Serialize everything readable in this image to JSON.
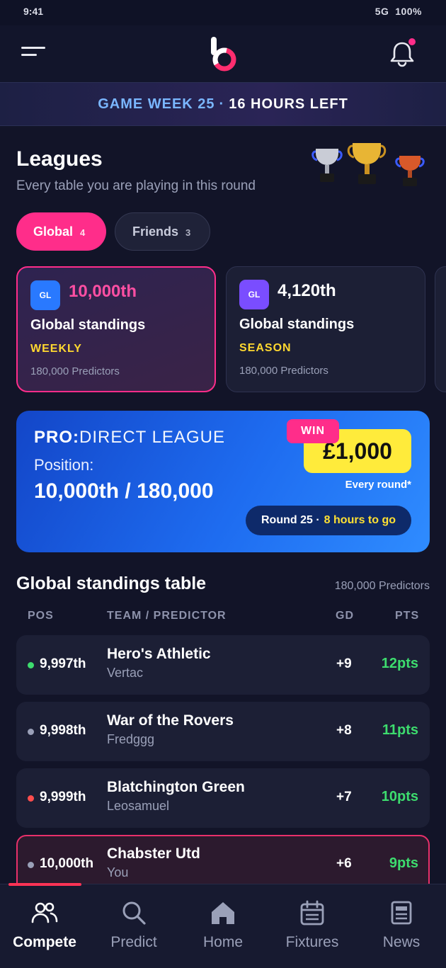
{
  "status_bar": {
    "time": "9:41",
    "network": "5G",
    "battery": "100%"
  },
  "header": {
    "menu_icon": "menu-icon",
    "logo": "b",
    "bell_icon": "bell-icon",
    "has_notification": true
  },
  "game_week": {
    "label": "GAME WEEK 25",
    "separator": "·",
    "time_left": "16 HOURS LEFT"
  },
  "leagues": {
    "title": "Leagues",
    "subtitle": "Every table you are playing in this round",
    "tabs": [
      {
        "label": "Global",
        "count": "4",
        "selected": true
      },
      {
        "label": "Friends",
        "count": "3",
        "selected": false
      }
    ],
    "cards": [
      {
        "badge": "GL",
        "rank": "10,000th",
        "name": "Global standings",
        "period": "WEEKLY",
        "predictors": "180,000 Predictors",
        "badge_color": "#2979ff",
        "rank_color": "#ff4fa3",
        "active": true
      },
      {
        "badge": "GL",
        "rank": "4,120th",
        "name": "Global standings",
        "period": "SEASON",
        "predictors": "180,000 Predictors",
        "badge_color": "#7a4dff",
        "rank_color": "#ffffff",
        "active": false
      }
    ]
  },
  "promo": {
    "brand_bold": "PRO:",
    "brand_thin": "DIRECT",
    "brand_suffix": "LEAGUE",
    "position_label": "Position:",
    "position_value": "10,000th / 180,000",
    "win_tag": "WIN",
    "prize": "£1,000",
    "prize_note": "Every round*",
    "round": "Round 25 ·",
    "round_time": "8 hours to go"
  },
  "standings": {
    "title": "Global standings table",
    "count": "180,000 Predictors",
    "columns": {
      "pos": "POS",
      "team": "TEAM / PREDICTOR",
      "gd": "GD",
      "pts": "PTS"
    },
    "rows": [
      {
        "pos": "9,997th",
        "team": "Hero's Athletic",
        "user": "Vertac",
        "gd": "+9",
        "pts": "12pts",
        "trend_color": "#3ddc6e",
        "you": false
      },
      {
        "pos": "9,998th",
        "team": "War of the Rovers",
        "user": "Fredggg",
        "gd": "+8",
        "pts": "11pts",
        "trend_color": "#9aa0b8",
        "you": false
      },
      {
        "pos": "9,999th",
        "team": "Blatchington Green",
        "user": "Leosamuel",
        "gd": "+7",
        "pts": "10pts",
        "trend_color": "#ff4d4d",
        "you": false
      },
      {
        "pos": "10,000th",
        "team": "Chabster Utd",
        "user": "You",
        "gd": "+6",
        "pts": "9pts",
        "trend_color": "#9aa0b8",
        "you": true
      }
    ]
  },
  "tabbar": {
    "items": [
      {
        "label": "Compete",
        "icon": "users-icon",
        "active": true
      },
      {
        "label": "Predict",
        "icon": "search-icon",
        "active": false
      },
      {
        "label": "Home",
        "icon": "home-icon",
        "active": false
      },
      {
        "label": "Fixtures",
        "icon": "calendar-icon",
        "active": false
      },
      {
        "label": "News",
        "icon": "news-icon",
        "active": false
      }
    ]
  },
  "colors": {
    "accent": "#ff2d8a",
    "highlight": "#ffd830",
    "positive": "#3ddc6e",
    "promo_blue": "#1e6cf0"
  }
}
